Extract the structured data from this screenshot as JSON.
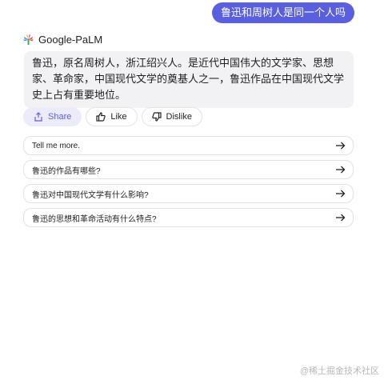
{
  "user_message": "鲁迅和周树人是同一个人吗",
  "bot": {
    "name": "Google-PaLM",
    "answer": "鲁迅，原名周树人，浙江绍兴人。是近代中国伟大的文学家、思想家、革命家，中国现代文学的奠基人之一，鲁迅作品在中国现代文学史上占有重要地位。"
  },
  "actions": {
    "share": "Share",
    "like": "Like",
    "dislike": "Dislike"
  },
  "suggestions": [
    "Tell me more.",
    "鲁迅的作品有哪些?",
    "鲁迅对中国现代文学有什么影响?",
    "鲁迅的思想和革命活动有什么特点?"
  ],
  "watermark": "@稀土掘金技术社区",
  "colors": {
    "accent": "#5a5fe0",
    "card_bg": "#f2f2f4"
  }
}
